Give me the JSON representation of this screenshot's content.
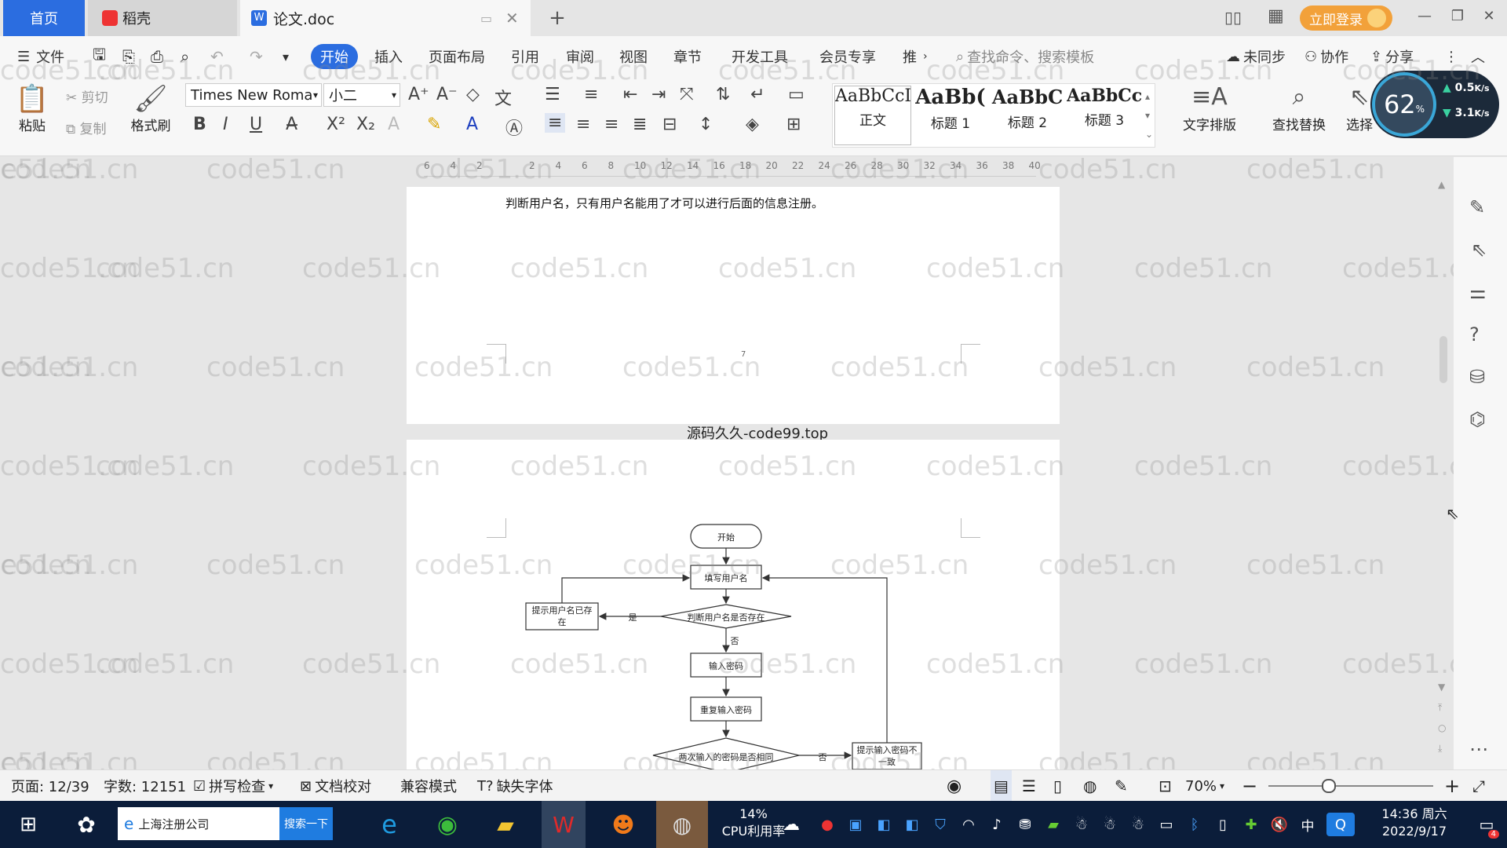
{
  "tabs": {
    "home": "首页",
    "daoke": "稻壳",
    "doc": "论文.doc"
  },
  "topbar": {
    "login": "立即登录"
  },
  "menu": {
    "file": "文件",
    "items": [
      "开始",
      "插入",
      "页面布局",
      "引用",
      "审阅",
      "视图",
      "章节",
      "开发工具",
      "会员专享",
      "推"
    ],
    "search_cmd": "查找命令、搜索模板",
    "sync": "未同步",
    "collab": "协作",
    "share": "分享"
  },
  "ribbon": {
    "paste": "粘贴",
    "cut": "剪切",
    "copy": "复制",
    "format_painter": "格式刷",
    "font_name": "Times New Roma",
    "font_size": "小二",
    "styles": [
      {
        "sample": "AaBbCcI",
        "label": "正文"
      },
      {
        "sample": "AaBb(",
        "label": "标题 1"
      },
      {
        "sample": "AaBbC",
        "label": "标题 2"
      },
      {
        "sample": "AaBbCcl",
        "label": "标题 3"
      }
    ],
    "text_layout": "文字排版",
    "find_replace": "查找替换",
    "select": "选择"
  },
  "perf": {
    "percent": "62",
    "unit": "%",
    "up": "0.5",
    "down": "3.1",
    "speed_unit": "K/s"
  },
  "ruler": {
    "ticks": [
      "6",
      "4",
      "2",
      "",
      "2",
      "4",
      "6",
      "8",
      "10",
      "12",
      "14",
      "16",
      "18",
      "20",
      "22",
      "24",
      "26",
      "28",
      "30",
      "32",
      "34",
      "36",
      "38",
      "40"
    ]
  },
  "document": {
    "body_text": "判断用户名，只有用户名能用了才可以进行后面的信息注册。",
    "page_number": "7",
    "source_banner": "源码久久-code99.top",
    "flowchart": {
      "start": "开始",
      "fill_username": "填写用户名",
      "check_exists": "判断用户名是否存在",
      "yes": "是",
      "user_exists": "提示用户名已存在",
      "no": "否",
      "enter_password": "输入密码",
      "repeat_password": "重复输入密码",
      "check_same": "两次输入的密码是否相同",
      "no2": "否",
      "password_mismatch": "提示输入密码不一致"
    }
  },
  "watermark": "code51.cn",
  "status": {
    "page": "页面: 12/39",
    "words": "字数: 12151",
    "spell": "拼写检查",
    "proof": "文档校对",
    "compat": "兼容模式",
    "missing_font": "缺失字体",
    "zoom": "70%"
  },
  "taskbar": {
    "search_text": "上海注册公司",
    "search_btn": "搜索一下",
    "cpu_percent": "14%",
    "cpu_label": "CPU利用率",
    "ime": "中",
    "time": "14:36 周六",
    "date": "2022/9/17",
    "notif": "4"
  }
}
